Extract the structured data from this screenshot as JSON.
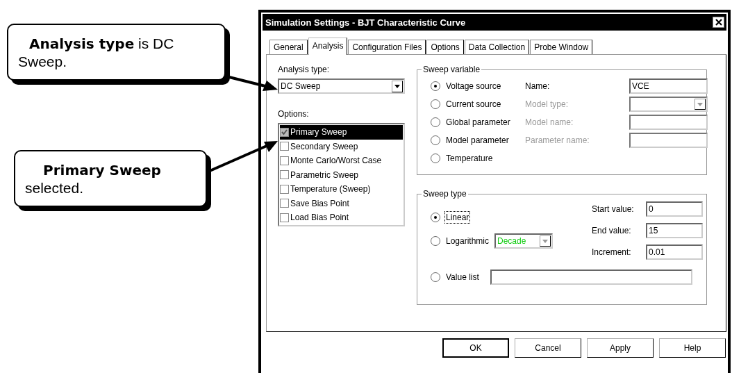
{
  "callouts": [
    {
      "text": "**Analysis type** is DC Sweep."
    },
    {
      "text": "**Primary Sweep** selected."
    }
  ],
  "window": {
    "title": "Simulation Settings - BJT Characteristic Curve"
  },
  "tabs": [
    {
      "label": "General",
      "selected": false
    },
    {
      "label": "Analysis",
      "selected": true
    },
    {
      "label": "Configuration Files",
      "selected": false
    },
    {
      "label": "Options",
      "selected": false
    },
    {
      "label": "Data Collection",
      "selected": false
    },
    {
      "label": "Probe Window",
      "selected": false
    }
  ],
  "analysis_type": {
    "label": "Analysis type:",
    "value": "DC Sweep"
  },
  "options": {
    "label": "Options:",
    "items": [
      {
        "label": "Primary Sweep",
        "checked": true,
        "selected": true
      },
      {
        "label": "Secondary Sweep",
        "checked": false,
        "selected": false
      },
      {
        "label": "Monte Carlo/Worst Case",
        "checked": false,
        "selected": false
      },
      {
        "label": "Parametric Sweep",
        "checked": false,
        "selected": false
      },
      {
        "label": "Temperature (Sweep)",
        "checked": false,
        "selected": false
      },
      {
        "label": "Save Bias Point",
        "checked": false,
        "selected": false
      },
      {
        "label": "Load Bias Point",
        "checked": false,
        "selected": false
      }
    ]
  },
  "sweep_variable": {
    "title": "Sweep variable",
    "sources": [
      {
        "label": "Voltage source",
        "selected": true
      },
      {
        "label": "Current source",
        "selected": false
      },
      {
        "label": "Global parameter",
        "selected": false
      },
      {
        "label": "Model parameter",
        "selected": false
      },
      {
        "label": "Temperature",
        "selected": false
      }
    ],
    "parameters": [
      {
        "label": "Name:",
        "kind": "field",
        "value": "VCE",
        "disabled": false
      },
      {
        "label": "Model type:",
        "kind": "dropdown",
        "disabled": true
      },
      {
        "label": "Model name:",
        "kind": "field",
        "disabled": true
      },
      {
        "label": "Parameter name:",
        "kind": "field",
        "disabled": true
      }
    ]
  },
  "sweep_type": {
    "title": "Sweep type",
    "types": [
      {
        "label": "Linear",
        "kind": "plain",
        "selected": true,
        "focused": true
      },
      {
        "label": "Logarithmic",
        "kind": "dropdown",
        "value": "Decade",
        "selected": false,
        "focused": false
      },
      {
        "label": "Value list",
        "kind": "field",
        "selected": false,
        "focused": false
      }
    ],
    "values": [
      {
        "label": "Start value:",
        "value": "0"
      },
      {
        "label": "End value:",
        "value": "15"
      },
      {
        "label": "Increment:",
        "value": "0.01"
      }
    ]
  },
  "buttons": [
    {
      "label": "OK",
      "default": true
    },
    {
      "label": "Cancel",
      "default": false
    },
    {
      "label": "Apply",
      "default": false
    },
    {
      "label": "Help",
      "default": false
    }
  ]
}
